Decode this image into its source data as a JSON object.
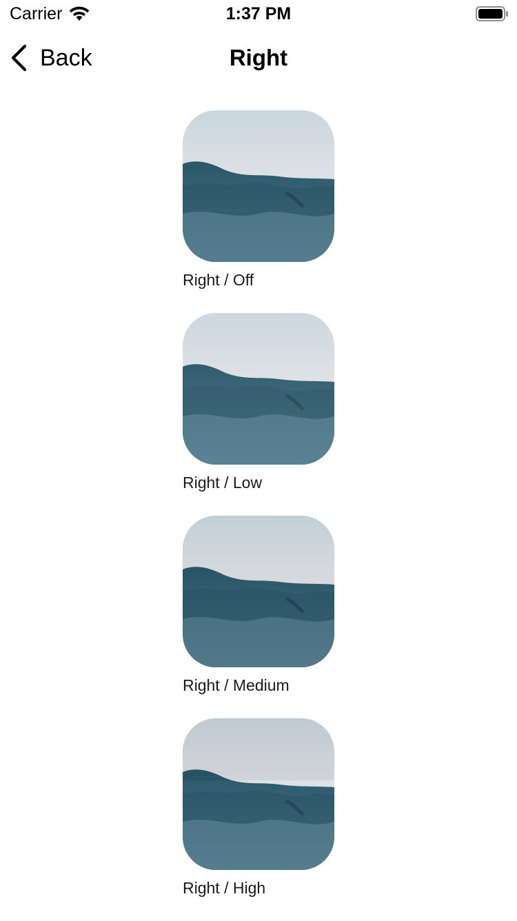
{
  "status_bar": {
    "carrier": "Carrier",
    "time": "1:37 PM",
    "wifi_icon": "wifi-icon",
    "battery_icon": "battery-icon"
  },
  "nav": {
    "back_label": "Back",
    "title": "Right",
    "back_icon": "chevron-left-icon"
  },
  "items": [
    {
      "caption": "Right / Off"
    },
    {
      "caption": "Right / Low"
    },
    {
      "caption": "Right / Medium"
    },
    {
      "caption": "Right / High"
    }
  ],
  "colors": {
    "text": "#000000",
    "background": "#ffffff",
    "sky_top": "#c9d6df",
    "sky_bottom": "#e8d8d6",
    "sea_dark": "#1f4656",
    "sea_light": "#6f95a6"
  }
}
